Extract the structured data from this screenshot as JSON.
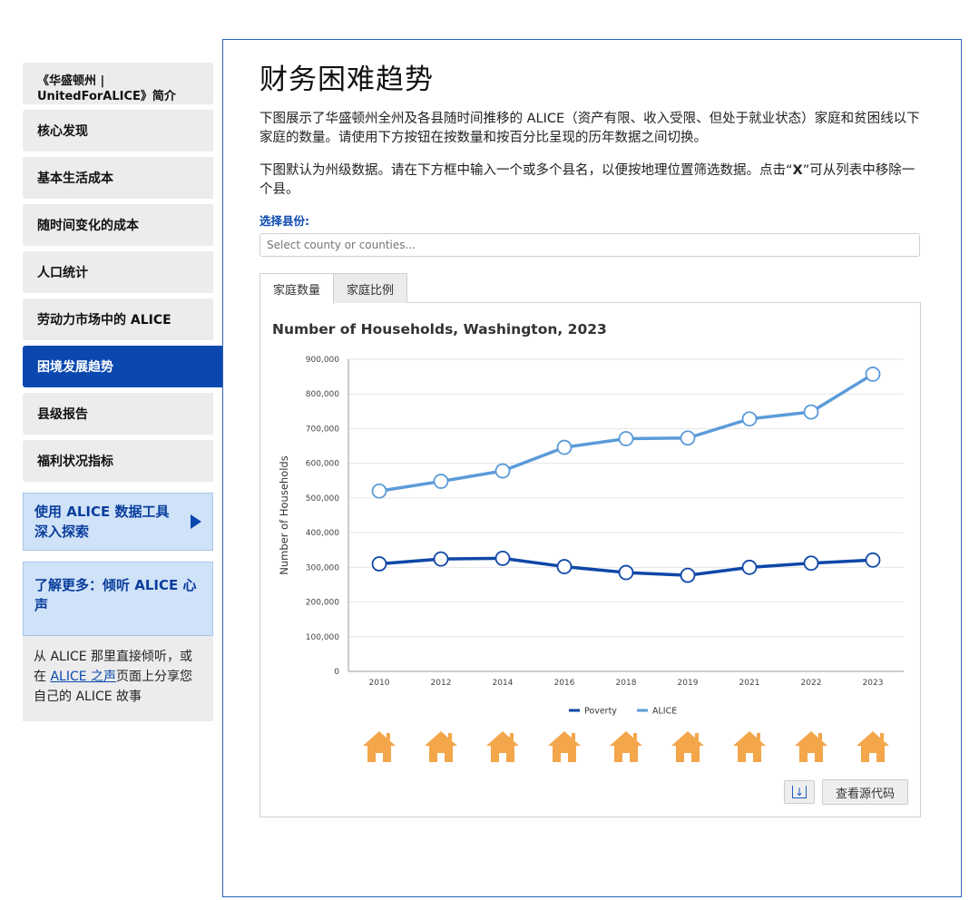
{
  "sidebar": {
    "items": [
      {
        "label": "《华盛顿州 | UnitedForALICE》简介"
      },
      {
        "label": "核心发现"
      },
      {
        "label": "基本生活成本"
      },
      {
        "label": "随时间变化的成本"
      },
      {
        "label": "人口统计"
      },
      {
        "label": "劳动力市场中的 ALICE"
      },
      {
        "label": "困境发展趋势"
      },
      {
        "label": "县级报告"
      },
      {
        "label": "福利状况指标"
      }
    ],
    "explore_label": "使用 ALICE 数据工具深入探索",
    "learn_label": "了解更多：倾听 ALICE 心声",
    "listen_text_before": "从 ALICE 那里直接倾听，或在 ",
    "listen_link": "ALICE 之声",
    "listen_text_after": "页面上分享您自己的 ALICE 故事"
  },
  "main": {
    "title": "财务困难趋势",
    "para1": "下图展示了华盛顿州全州及各县随时间推移的 ALICE（资产有限、收入受限、但处于就业状态）家庭和贫困线以下家庭的数量。请使用下方按钮在按数量和按百分比呈现的历年数据之间切换。",
    "para2_before": "下图默认为州级数据。请在下方框中输入一个或多个县名，以便按地理位置筛选数据。点击“",
    "para2_bold": "X",
    "para2_after": "”可从列表中移除一个县。",
    "select_label": "选择县份:",
    "select_placeholder": "Select county or counties...",
    "tabs": [
      {
        "label": "家庭数量"
      },
      {
        "label": "家庭比例"
      }
    ],
    "view_source_label": "查看源代码",
    "download_glyph": "↓"
  },
  "colors": {
    "poverty": "#0f47a8",
    "alice": "#5b9bd9",
    "house": "#f3a64a",
    "active_nav": "#0a48b0"
  },
  "chart_data": {
    "type": "line",
    "title": "Number of Households, Washington, 2023",
    "ylabel": "Number of Households",
    "xlabel": "",
    "categories": [
      "2010",
      "2012",
      "2014",
      "2016",
      "2018",
      "2019",
      "2021",
      "2022",
      "2023"
    ],
    "yticks": [
      "0",
      "100,000",
      "200,000",
      "300,000",
      "400,000",
      "500,000",
      "600,000",
      "700,000",
      "800,000",
      "900,000"
    ],
    "ylim": [
      0,
      900000
    ],
    "series": [
      {
        "name": "Poverty",
        "values": [
          310000,
          324000,
          326000,
          302000,
          285000,
          277000,
          300000,
          312000,
          321000
        ]
      },
      {
        "name": "ALICE",
        "values": [
          520000,
          548000,
          578000,
          646000,
          671000,
          673000,
          728000,
          748000,
          857000
        ]
      }
    ],
    "legend": "bottom-center",
    "grid": true
  }
}
